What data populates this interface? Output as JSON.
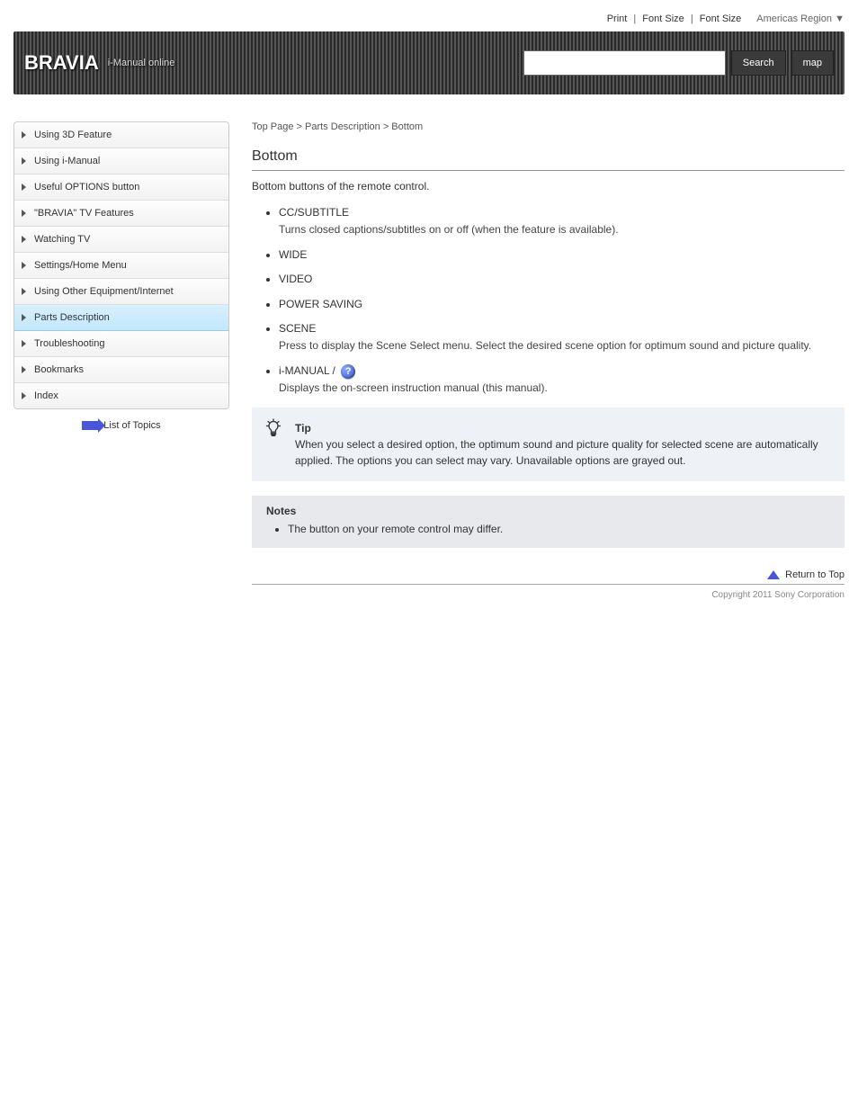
{
  "top_links": {
    "print": "Print",
    "font1": "Font Size",
    "font2": "Font Size",
    "region_label": "Americas Region",
    "region_arrow": "▼"
  },
  "header": {
    "brand": "BRAVIA",
    "brand_sub": "i-Manual online",
    "search_placeholder": "",
    "search_btn": "Search",
    "map_btn": "map"
  },
  "sidebar": {
    "items": [
      {
        "label": "Using 3D Feature"
      },
      {
        "label": "Using i-Manual"
      },
      {
        "label": "Useful OPTIONS button"
      },
      {
        "label": "\"BRAVIA\" TV Features"
      },
      {
        "label": "Watching TV"
      },
      {
        "label": "Settings/Home Menu"
      },
      {
        "label": "Using Other Equipment/Internet"
      },
      {
        "label": "Parts Description"
      },
      {
        "label": "Troubleshooting"
      },
      {
        "label": "Bookmarks"
      },
      {
        "label": "Index"
      }
    ],
    "active_index": 7,
    "list_topics": "List of Topics"
  },
  "content": {
    "breadcrumb": "Top Page > Parts Description > Bottom",
    "title": "Bottom",
    "intro": "Bottom buttons of the remote control.",
    "steps": [
      {
        "main": "CC/SUBTITLE",
        "sub": "Turns closed captions/subtitles on or off (when the feature is available)."
      },
      {
        "main": "WIDE",
        "sub": ""
      },
      {
        "main": "VIDEO",
        "sub": ""
      },
      {
        "main": "POWER SAVING",
        "sub": ""
      },
      {
        "main": "SCENE",
        "sub": "Press to display the Scene Select menu. Select the desired scene option for optimum sound and picture quality."
      },
      {
        "main": "i-MANUAL / ",
        "sub": "Displays the on-screen instruction manual (this manual).",
        "has_help_icon": true
      }
    ],
    "tip": {
      "label": "Tip",
      "text": "When you select a desired option, the optimum sound and picture quality for selected scene are automatically applied. The options you can select may vary. Unavailable options are grayed out."
    },
    "notes": {
      "label": "Notes",
      "items": [
        "The button on your remote control may differ."
      ]
    }
  },
  "footer": {
    "return_top": "Return to Top",
    "copyright": "Copyright 2011 Sony Corporation"
  }
}
